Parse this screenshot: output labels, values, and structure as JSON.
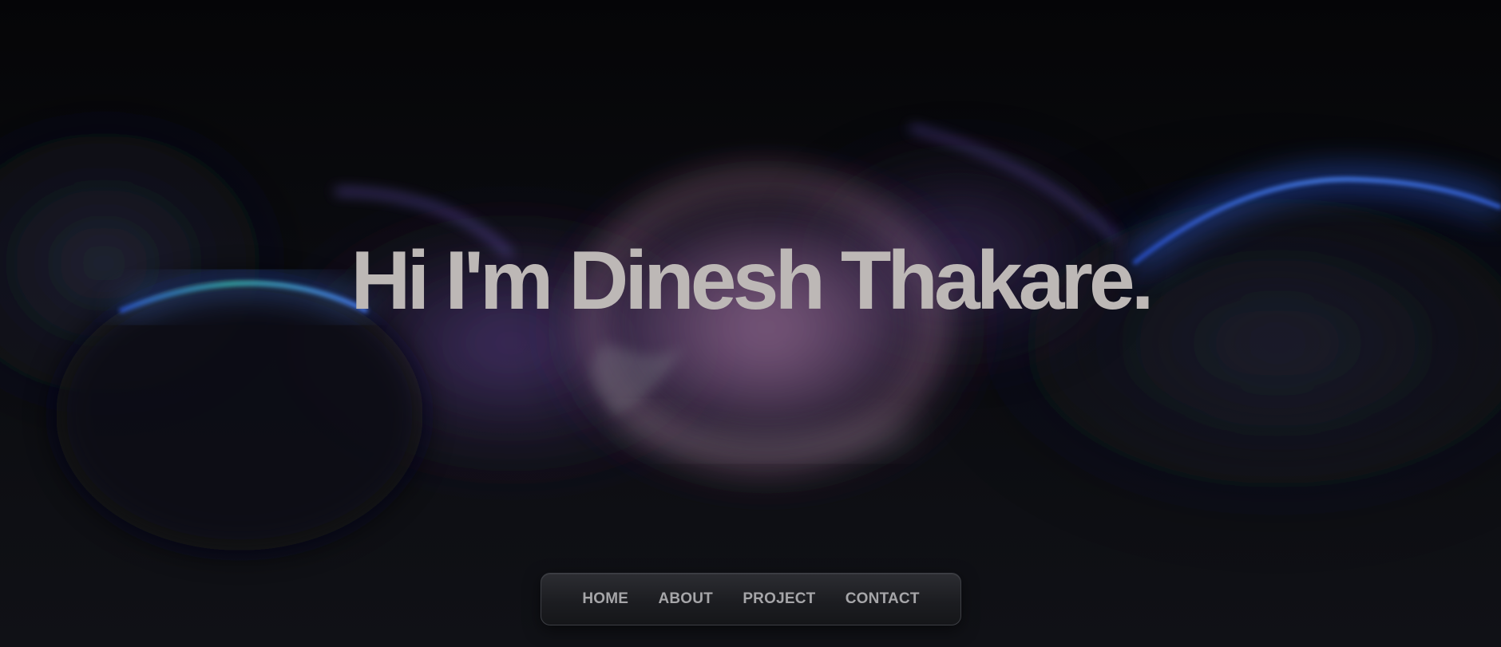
{
  "hero": {
    "title": "Hi I'm Dinesh Thakare."
  },
  "nav": {
    "items": [
      {
        "label": "HOME"
      },
      {
        "label": "ABOUT"
      },
      {
        "label": "PROJECT"
      },
      {
        "label": "CONTACT"
      }
    ]
  },
  "colors": {
    "background": "#0b0c10",
    "title_text": "#bdb8b6",
    "nav_text": "#a6a6a9",
    "accent_blue": "#3a6cf0",
    "accent_purple": "#7a5fd0",
    "accent_pink": "#b07aa8"
  }
}
